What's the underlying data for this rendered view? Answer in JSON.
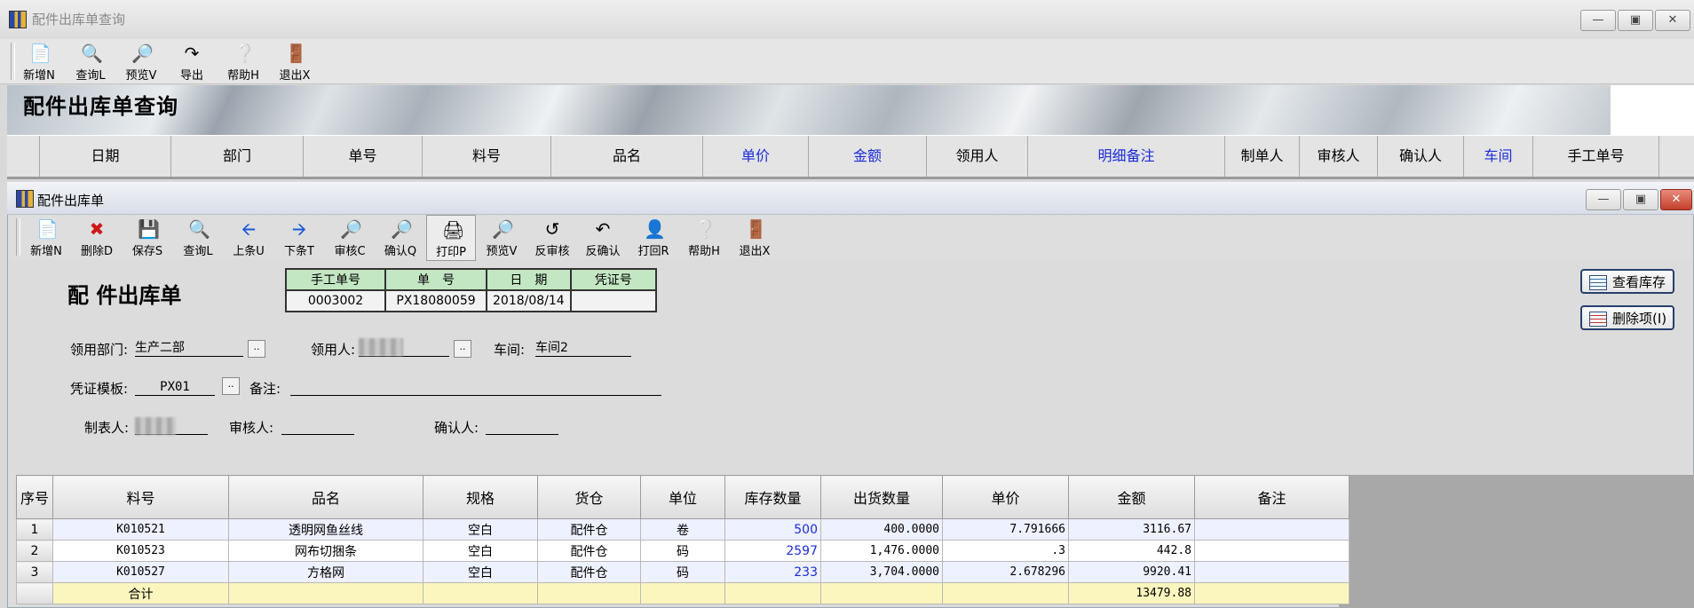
{
  "outer_window": {
    "title": "配件出库单查询"
  },
  "outer_toolbar": [
    {
      "label": "新增N",
      "icon": "new-doc-icon"
    },
    {
      "label": "查询L",
      "icon": "query-icon"
    },
    {
      "label": "预览V",
      "icon": "preview-icon"
    },
    {
      "label": "导出",
      "icon": "export-icon"
    },
    {
      "label": "帮助H",
      "icon": "help-icon"
    },
    {
      "label": "退出X",
      "icon": "exit-icon"
    }
  ],
  "banner": {
    "title": "配件出库单查询"
  },
  "query_columns": [
    "日期",
    "部门",
    "单号",
    "料号",
    "品名",
    "单价",
    "金额",
    "领用人",
    "明细备注",
    "制单人",
    "审核人",
    "确认人",
    "车间",
    "手工单号"
  ],
  "inner_window": {
    "title": "配件出库单"
  },
  "inner_toolbar": [
    {
      "label": "新增N",
      "icon": "new-doc-icon"
    },
    {
      "label": "删除D",
      "icon": "delete-icon"
    },
    {
      "label": "保存S",
      "icon": "save-icon"
    },
    {
      "label": "查询L",
      "icon": "query-icon"
    },
    {
      "label": "上条U",
      "icon": "prev-icon"
    },
    {
      "label": "下条T",
      "icon": "next-icon"
    },
    {
      "label": "审核C",
      "icon": "audit-icon"
    },
    {
      "label": "确认Q",
      "icon": "confirm-icon"
    },
    {
      "label": "打印P",
      "icon": "print-icon"
    },
    {
      "label": "预览V",
      "icon": "preview-icon"
    },
    {
      "label": "反审核",
      "icon": "unaudit-icon"
    },
    {
      "label": "反确认",
      "icon": "unconfirm-icon"
    },
    {
      "label": "打回R",
      "icon": "return-icon"
    },
    {
      "label": "帮助H",
      "icon": "help-icon"
    },
    {
      "label": "退出X",
      "icon": "exit-icon"
    }
  ],
  "form": {
    "title": "配 件出库单",
    "header_box": {
      "labels": [
        "手工单号",
        "单　号",
        "日　期",
        "凭证号"
      ],
      "values": [
        "0003002",
        "PX18080059",
        "2018/08/14",
        ""
      ]
    },
    "dept_label": "领用部门:",
    "dept_value": "生产二部",
    "receiver_label": "领用人:",
    "workshop_label": "车间:",
    "workshop_value": "车间2",
    "voucher_template_label": "凭证模板:",
    "voucher_template_value": "PX01",
    "remark_label": "备注:",
    "creator_label": "制表人:",
    "auditor_label": "审核人:",
    "confirmer_label": "确认人:",
    "dots_label": "..",
    "btn_check_stock": "查看库存",
    "btn_delete_item": "删除项(I)"
  },
  "grid": {
    "columns": [
      "序号",
      "料号",
      "品名",
      "规格",
      "货仓",
      "单位",
      "库存数量",
      "出货数量",
      "单价",
      "金额",
      "备注"
    ],
    "rows": [
      {
        "seq": "1",
        "code": "K010521",
        "name": "透明网鱼丝线",
        "spec": "空白",
        "warehouse": "配件仓",
        "unit": "卷",
        "stock": "500",
        "qty": "400.0000",
        "price": "7.791666",
        "amount": "3116.67",
        "remark": ""
      },
      {
        "seq": "2",
        "code": "K010523",
        "name": "网布切捆条",
        "spec": "空白",
        "warehouse": "配件仓",
        "unit": "码",
        "stock": "2597",
        "qty": "1,476.0000",
        "price": ".3",
        "amount": "442.8",
        "remark": ""
      },
      {
        "seq": "3",
        "code": "K010527",
        "name": "方格网",
        "spec": "空白",
        "warehouse": "配件仓",
        "unit": "码",
        "stock": "233",
        "qty": "3,704.0000",
        "price": "2.678296",
        "amount": "9920.41",
        "remark": ""
      }
    ],
    "total": {
      "label": "合计",
      "amount": "13479.88"
    }
  },
  "colors": {
    "blue_text": "#1a2cd8",
    "sum_row": "#fbf6be",
    "odd_row": "#eef1ff"
  }
}
